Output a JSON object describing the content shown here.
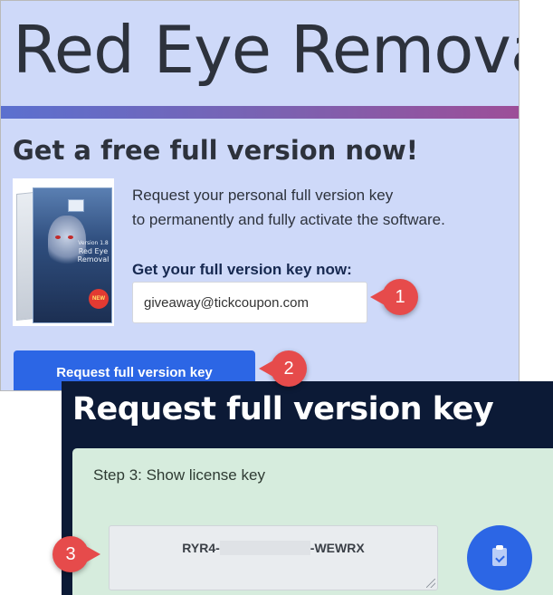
{
  "app": {
    "title": "Red Eye Removal",
    "accent_color": "#2c66e5",
    "panel_bg": "#ced9f9"
  },
  "giveaway": {
    "headline": "Get a free full version now!",
    "intro_line_1": "Request your personal full version key",
    "intro_line_2": "to permanently and fully activate the software.",
    "key_label": "Get your full version key now:",
    "email_value": "giveaway@tickcoupon.com",
    "request_button_label": "Request full version key",
    "product_box": {
      "version": "Version 1.8",
      "name_line_1": "Red Eye",
      "name_line_2": "Removal",
      "badge": "NEW"
    }
  },
  "callouts": [
    "1",
    "2",
    "3"
  ],
  "license_dialog": {
    "title": "Request full version key",
    "step_label": "Step 3: Show license key",
    "key_prefix": "RYR4-",
    "key_suffix": "-WEWRX",
    "copy_icon": "clipboard-check-icon",
    "card_color": "#d6ecdd",
    "header_color": "#0c1a36"
  }
}
